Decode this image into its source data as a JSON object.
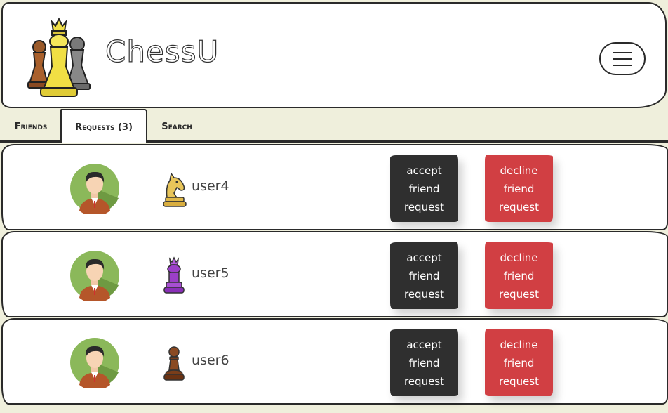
{
  "header": {
    "app_title": "ChessU",
    "logo_icon": "chess-pieces-logo-icon",
    "menu_icon": "hamburger-menu-icon"
  },
  "tabs": [
    {
      "label": "Friends",
      "active": false
    },
    {
      "label": "Requests (3)",
      "active": true
    },
    {
      "label": "Search",
      "active": false
    }
  ],
  "requests": [
    {
      "username": "user4",
      "piece_icon": "knight-icon",
      "piece_color": "#e8c55a",
      "accept_label": "accept friend request",
      "decline_label": "decline friend request"
    },
    {
      "username": "user5",
      "piece_icon": "king-icon",
      "piece_color": "#9b3fc8",
      "accept_label": "accept friend request",
      "decline_label": "decline friend request"
    },
    {
      "username": "user6",
      "piece_icon": "pawn-icon",
      "piece_color": "#8a4a22",
      "accept_label": "accept friend request",
      "decline_label": "decline friend request"
    }
  ],
  "colors": {
    "accept": "#2f2f2f",
    "decline": "#d13f43",
    "background": "#efefdc",
    "avatar_bg": "#8bb85a"
  }
}
